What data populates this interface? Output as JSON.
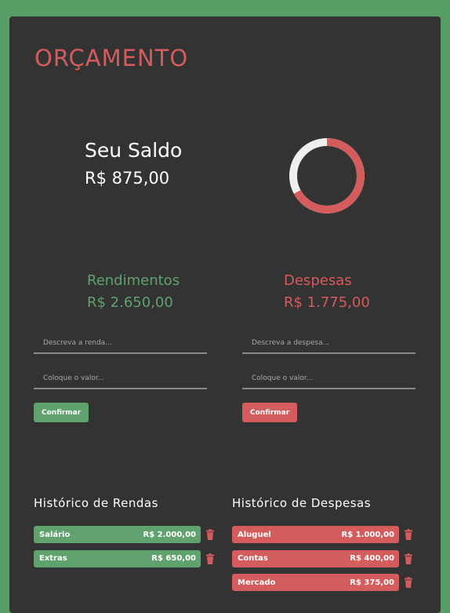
{
  "header": {
    "title": "ORÇAMENTO"
  },
  "balance": {
    "label": "Seu Saldo",
    "value": "R$ 875,00"
  },
  "donut": {
    "expense_fraction": 0.6698,
    "income_color": "#efefef",
    "expense_color": "#d55c5c"
  },
  "income": {
    "title": "Rendimentos",
    "total": "R$ 2.650,00",
    "description_placeholder": "Descreva a renda...",
    "value_placeholder": "Coloque o valor...",
    "confirm_label": "Confirmar"
  },
  "expense": {
    "title": "Despesas",
    "total": "R$ 1.775,00",
    "description_placeholder": "Descreva a despesa...",
    "value_placeholder": "Coloque o valor...",
    "confirm_label": "Confirmar"
  },
  "income_history": {
    "title": "Histórico de Rendas",
    "items": [
      {
        "name": "Salário",
        "amount": "R$ 2.000,00"
      },
      {
        "name": "Extras",
        "amount": "R$ 650,00"
      }
    ]
  },
  "expense_history": {
    "title": "Histórico de Despesas",
    "items": [
      {
        "name": "Aluguel",
        "amount": "R$ 1.000,00"
      },
      {
        "name": "Contas",
        "amount": "R$ 400,00"
      },
      {
        "name": "Mercado",
        "amount": "R$ 375,00"
      }
    ]
  },
  "colors": {
    "brand_green": "#5fa26e",
    "brand_red": "#d55c5c",
    "card_bg": "#333333",
    "page_bg": "#579e66"
  },
  "icons": {
    "delete": "trash-icon"
  }
}
